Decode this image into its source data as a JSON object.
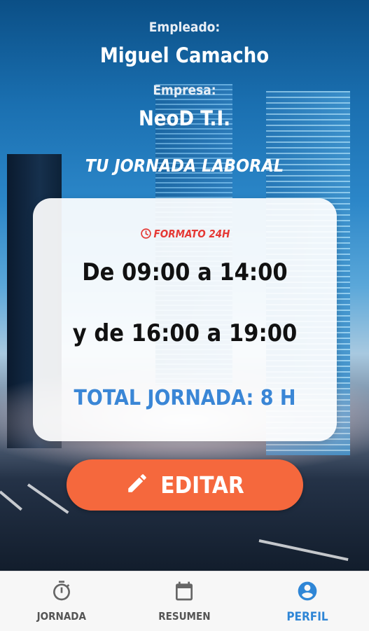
{
  "profile": {
    "employee_label": "Empleado:",
    "employee_name": "Miguel Camacho",
    "company_label": "Empresa:",
    "company_name": "NeoD T.I."
  },
  "schedule": {
    "title": "TU JORNADA LABORAL",
    "format_label": "FORMATO 24H",
    "shift_line_1": "De 09:00 a 14:00",
    "shift_line_2": "y de 16:00 a 19:00",
    "total_label": "TOTAL JORNADA: 8 H"
  },
  "actions": {
    "edit_label": "EDITAR"
  },
  "bottom_nav": {
    "items": [
      {
        "label": "JORNADA",
        "icon": "stopwatch-icon"
      },
      {
        "label": "RESUMEN",
        "icon": "calendar-icon"
      },
      {
        "label": "PERFIL",
        "icon": "account-circle-icon",
        "active": true
      }
    ]
  },
  "colors": {
    "accent_orange": "#f5683d",
    "accent_blue": "#2f86d6",
    "format_red": "#e53935"
  }
}
